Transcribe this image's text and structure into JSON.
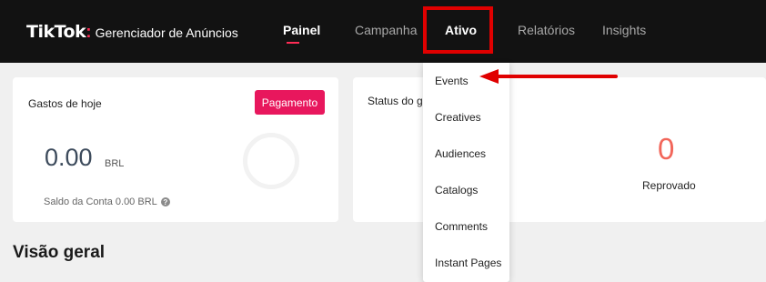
{
  "brand": {
    "logo": "TikTok",
    "colon": ":",
    "subtitle": "Gerenciador de Anúncios"
  },
  "nav": {
    "items": [
      {
        "label": "Painel",
        "active": true
      },
      {
        "label": "Campanha",
        "active": false
      },
      {
        "label": "Ativo",
        "active": false,
        "highlighted": true
      },
      {
        "label": "Relatórios",
        "active": false
      },
      {
        "label": "Insights",
        "active": false
      }
    ]
  },
  "spend_card": {
    "title": "Gastos de hoje",
    "pay_button": "Pagamento",
    "value": "0.00",
    "currency": "BRL",
    "balance": "Saldo da Conta 0.00 BRL"
  },
  "status_card": {
    "title": "Status do gr",
    "rejected_count": "0",
    "rejected_label": "Reprovado"
  },
  "overview": {
    "title": "Visão geral"
  },
  "dropdown": {
    "items": [
      "Events",
      "Creatives",
      "Audiences",
      "Catalogs",
      "Comments",
      "Instant Pages"
    ]
  },
  "colors": {
    "topbar": "#121212",
    "accent": "#fe2c55",
    "pay_button": "#e8175d",
    "highlight_box": "#e00000",
    "rejected": "#f2665a"
  },
  "icons": {
    "help": "question-circle-icon",
    "annotation_arrow": "red-arrow-icon"
  }
}
